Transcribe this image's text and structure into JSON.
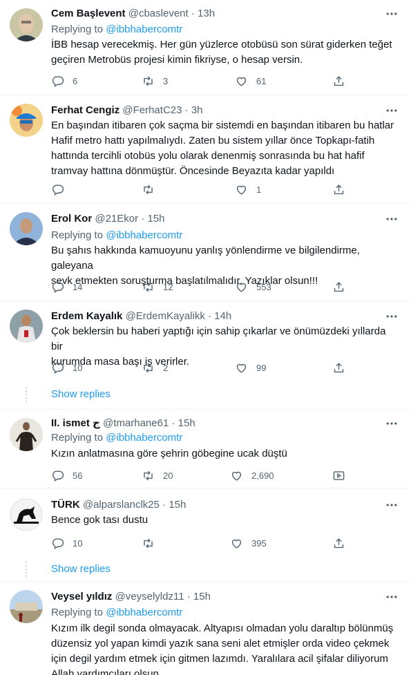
{
  "tweets": [
    {
      "name": "Cem Başlevent",
      "handle": "@cbaslevent",
      "time": "13h",
      "replying_label": "Replying to",
      "replying_to": "@ibbhabercomtr",
      "text_lines": [
        "İBB hesap verecekmiş. Her gün yüzlerce otobüsü son sürat giderken teğet",
        "geçiren Metrobüs projesi kimin fikriyse, o hesap versin."
      ],
      "replies": "6",
      "retweets": "3",
      "likes": "61"
    },
    {
      "name": "Ferhat Cengiz",
      "handle": "@FerhatC23",
      "time": "3h",
      "replying_label": "",
      "replying_to": "",
      "text_lines": [
        "En başından itibaren çok saçma bir sistemdi en başından itibaren bu hatlar",
        "Hafif metro hattı yapılmalıydı. Zaten bu sistem yıllar önce Topkapı-fatih",
        "hattında tercihli otobüs yolu olarak denenmiş sonrasında bu hat hafif",
        "tramvay hattına dönmüştür. Öncesinde Beyazıta kadar yapıldı"
      ],
      "replies": "",
      "retweets": "",
      "likes": "1"
    },
    {
      "name": "Erol Kor",
      "handle": "@21Ekor",
      "time": "15h",
      "replying_label": "Replying to",
      "replying_to": "@ibbhabercomtr",
      "text_lines": [
        "Bu şahıs hakkında kamuoyunu yanlış yönlendirme ve bilgilendirme, galeyana",
        "sevk etmekten soruşturma başlatılmalıdır. Yazıklar olsun!!!"
      ],
      "replies": "14",
      "retweets": "12",
      "likes": "553"
    },
    {
      "name": "Erdem Kayalık",
      "handle": "@ErdemKayalikk",
      "time": "14h",
      "replying_label": "",
      "replying_to": "",
      "text_lines": [
        "Çok beklersin bu haberi yaptığı için sahip çıkarlar ve önümüzdeki yıllarda bir",
        "kurumda masa başı iş verirler."
      ],
      "replies": "10",
      "retweets": "2",
      "likes": "99"
    },
    {
      "name": "II. ismet ج",
      "handle": "@tmarhane61",
      "time": "15h",
      "replying_label": "Replying to",
      "replying_to": "@ibbhabercomtr",
      "text_lines": [
        "Kızın anlatmasına göre şehrin göbegine ucak düştü"
      ],
      "replies": "56",
      "retweets": "20",
      "likes": "2,690"
    },
    {
      "name": "TÜRK",
      "handle": "@alparslanclk25",
      "time": "15h",
      "replying_label": "",
      "replying_to": "",
      "text_lines": [
        "Bence gok tası dustu"
      ],
      "replies": "10",
      "retweets": "",
      "likes": "395"
    },
    {
      "name": "Veysel yıldız",
      "handle": "@veyselyldz11",
      "time": "15h",
      "replying_label": "Replying to",
      "replying_to": "@ibbhabercomtr",
      "text_lines": [
        "Kızım  ilk degil sonda olmayacak. Altyapısı olmadan yolu daraltıp bölünmüş",
        "düzensiz yol yapan kimdi yazık sana seni alet etmişler orda video çekmek",
        "için degil yardım etmek için gitmen lazımdı. Yaralılara acil şifalar diliyorum",
        "Allah yardımcıları olsun."
      ],
      "replies": "",
      "retweets": "",
      "likes": ""
    }
  ],
  "show_replies_label": "Show replies",
  "separator": " · ",
  "icons": {
    "reply": "reply-icon",
    "retweet": "retweet-icon",
    "like": "heart-icon",
    "share": "share-icon",
    "more": "more-icon"
  },
  "colors": {
    "link": "#1d9bf0",
    "muted": "#536471",
    "text": "#0f1419",
    "divider": "#eff3f4"
  }
}
